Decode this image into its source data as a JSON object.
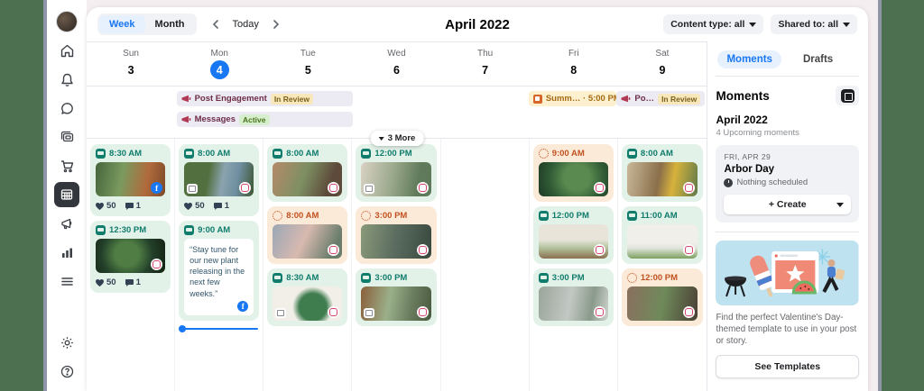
{
  "colors": {
    "accent_blue": "#1877F2",
    "post_time_teal": "#0F7C6C",
    "story_time_orange": "#C1511F",
    "edge_green": "#4D7050",
    "green_card_bg": "#E3F2E9",
    "orange_card_bg": "#FCEAD9"
  },
  "topbar": {
    "week_label": "Week",
    "month_label": "Month",
    "today_label": "Today",
    "title": "April 2022",
    "content_type_filter": "Content type: all",
    "shared_to_filter": "Shared to: all"
  },
  "calendar": {
    "days": [
      {
        "name": "Sun",
        "num": "3"
      },
      {
        "name": "Mon",
        "num": "4"
      },
      {
        "name": "Tue",
        "num": "5"
      },
      {
        "name": "Wed",
        "num": "6"
      },
      {
        "name": "Thu",
        "num": "7"
      },
      {
        "name": "Fri",
        "num": "8"
      },
      {
        "name": "Sat",
        "num": "9"
      }
    ],
    "allday": [
      {
        "label": "Post Engagement",
        "badge": "In Review"
      },
      {
        "label": "Messages",
        "badge": "Active"
      },
      {
        "label": "Summ… · 5:00 PM"
      },
      {
        "label": "Po…",
        "badge": "In Review"
      }
    ],
    "more_label": "3 More",
    "columns": {
      "sun": [
        {
          "time": "8:30 AM",
          "likes": "50",
          "comments": "1"
        },
        {
          "time": "12:30 PM",
          "likes": "50",
          "comments": "1"
        }
      ],
      "mon": [
        {
          "time": "8:00 AM",
          "likes": "50",
          "comments": "1"
        },
        {
          "time": "9:00 AM",
          "text": "“Stay tune for our new plant releasing in the next few weeks.”"
        }
      ],
      "tue": [
        {
          "time": "8:00 AM"
        },
        {
          "time": "8:00 AM"
        },
        {
          "time": "8:30 AM"
        }
      ],
      "wed": [
        {
          "time": "12:00 PM"
        },
        {
          "time": "3:00 PM"
        },
        {
          "time": "3:00 PM"
        }
      ],
      "fri": [
        {
          "time": "9:00 AM"
        },
        {
          "time": "12:00 PM"
        },
        {
          "time": "3:00 PM"
        }
      ],
      "sat": [
        {
          "time": "8:00 AM"
        },
        {
          "time": "11:00 AM"
        },
        {
          "time": "12:00 PM"
        }
      ]
    }
  },
  "panel": {
    "tabs": {
      "moments": "Moments",
      "drafts": "Drafts"
    },
    "heading": "Moments",
    "month": "April 2022",
    "upcoming": "4 Upcoming moments",
    "moment": {
      "date": "FRI, APR 29",
      "title": "Arbor Day",
      "status": "Nothing scheduled",
      "create_label": "+ Create"
    },
    "promo": {
      "text": "Find the perfect Valentine's Day-themed template to use in your post or story.",
      "button": "See Templates"
    }
  }
}
